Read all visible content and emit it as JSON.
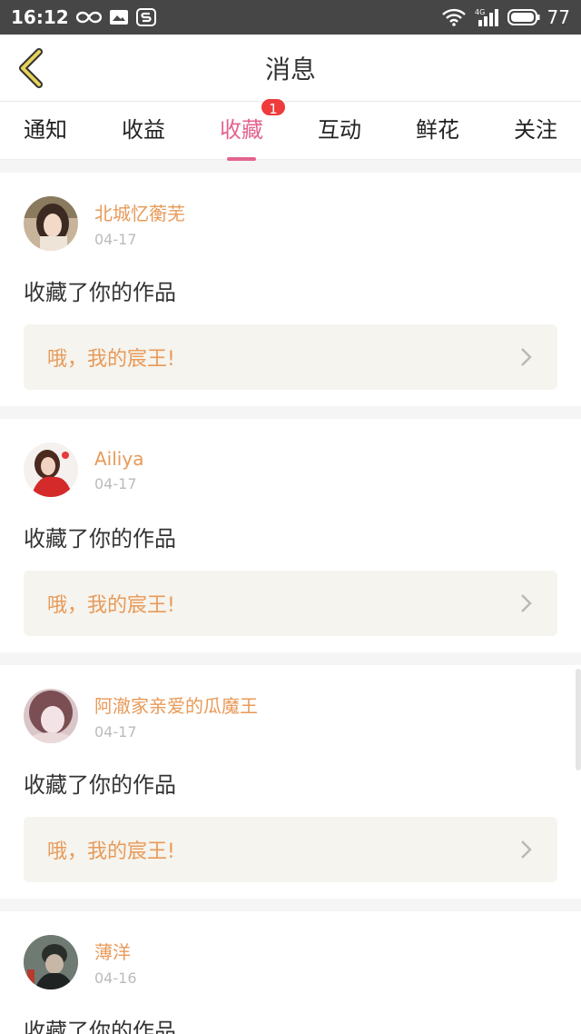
{
  "status_bar": {
    "time": "16:12",
    "battery": "77",
    "network": "4G",
    "icons": [
      "infinity-icon",
      "notification-icon",
      "app-s-icon",
      "wifi-icon",
      "signal-icon",
      "battery-icon"
    ]
  },
  "header": {
    "title": "消息",
    "back_icon": "chevron-left-icon",
    "accent_color": "#e8d35a"
  },
  "tabs": [
    {
      "label": "通知",
      "active": false
    },
    {
      "label": "收益",
      "active": false
    },
    {
      "label": "收藏",
      "active": true,
      "badge": "1"
    },
    {
      "label": "互动",
      "active": false
    },
    {
      "label": "鲜花",
      "active": false
    },
    {
      "label": "关注",
      "active": false
    }
  ],
  "messages": [
    {
      "user": "北城忆蘅芜",
      "date": "04-17",
      "action": "收藏了你的作品",
      "work": "哦，我的宸王!",
      "avatar": "avatar-girl-photo"
    },
    {
      "user": "Ailiya",
      "date": "04-17",
      "action": "收藏了你的作品",
      "work": "哦，我的宸王!",
      "avatar": "avatar-girl-red-photo"
    },
    {
      "user": "阿澈家亲爱的瓜魔王",
      "date": "04-17",
      "action": "收藏了你的作品",
      "work": "哦，我的宸王!",
      "avatar": "avatar-blurred-photo"
    },
    {
      "user": "薄洋",
      "date": "04-16",
      "action": "收藏了你的作品",
      "work": "",
      "avatar": "avatar-dark-photo"
    }
  ],
  "colors": {
    "active_tab": "#e3648e",
    "username": "#e89a59",
    "work_title": "#e89a59",
    "badge": "#ef3b3b",
    "work_box_bg": "#f5f4ee"
  }
}
